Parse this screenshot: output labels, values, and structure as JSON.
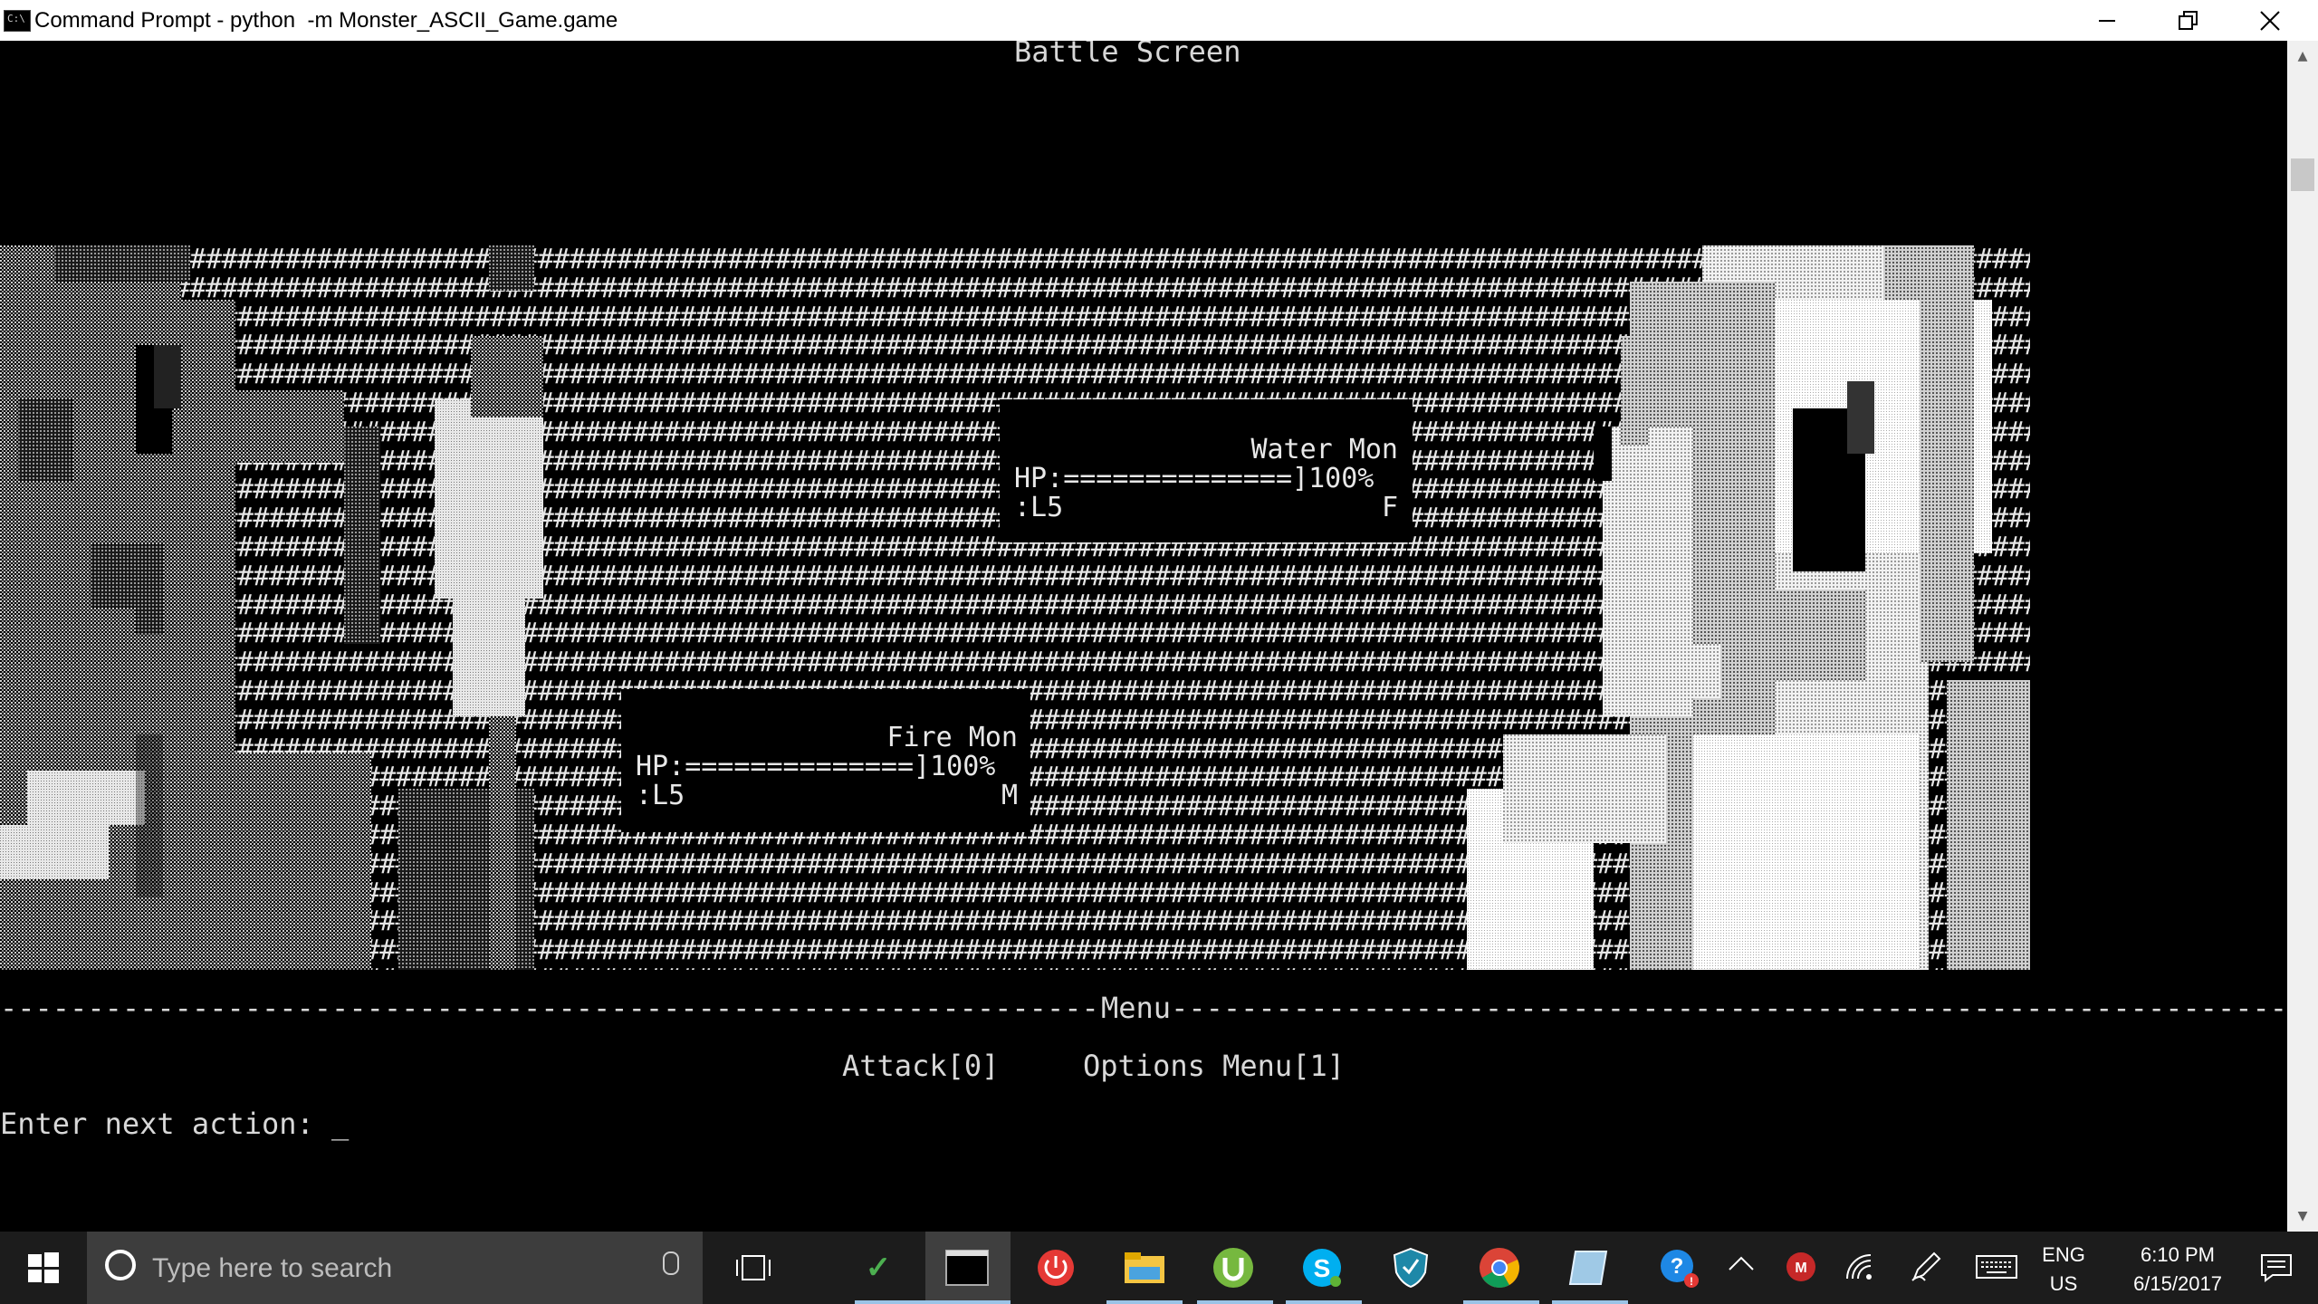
{
  "window": {
    "title": "Command Prompt - python  -m Monster_ASCII_Game.game",
    "icon_text": "C:\\",
    "minimize_icon": "minimize-icon",
    "restore_icon": "restore-icon",
    "close_icon": "close-icon"
  },
  "screen": {
    "title": "Battle Screen"
  },
  "enemy": {
    "name": "Water Mon",
    "hp_label": "HP:",
    "hp_bar": "==============]",
    "hp_percent": "100%",
    "level": ":L5",
    "gender": "F"
  },
  "player": {
    "name": "Fire Mon",
    "hp_label": "HP:",
    "hp_bar": "==============]",
    "hp_percent": "100%",
    "level": ":L5",
    "gender": "M"
  },
  "menu": {
    "divider_left": "------------------------------------------------------------------------------------------------",
    "divider_label": "Menu",
    "divider_right": "-----------------------------------------------------------------------------------------------------------",
    "option_attack": "Attack[0]",
    "option_options": "Options Menu[1]"
  },
  "prompt": {
    "text": "Enter next action: ",
    "cursor": "_"
  },
  "taskbar": {
    "search_placeholder": "Type here to search",
    "language_top": "ENG",
    "language_bottom": "US",
    "time": "6:10 PM",
    "date": "6/15/2017",
    "pinned_icons": [
      "vim-icon",
      "command-prompt-icon",
      "power-icon",
      "file-explorer-icon",
      "utorrent-icon",
      "skype-icon",
      "shield-icon",
      "chrome-icon",
      "app-icon"
    ],
    "tray_icons": [
      "help-icon",
      "show-hidden-icons-icon",
      "mcafee-icon",
      "wifi-icon",
      "pen-icon",
      "keyboard-icon",
      "notifications-icon"
    ]
  }
}
